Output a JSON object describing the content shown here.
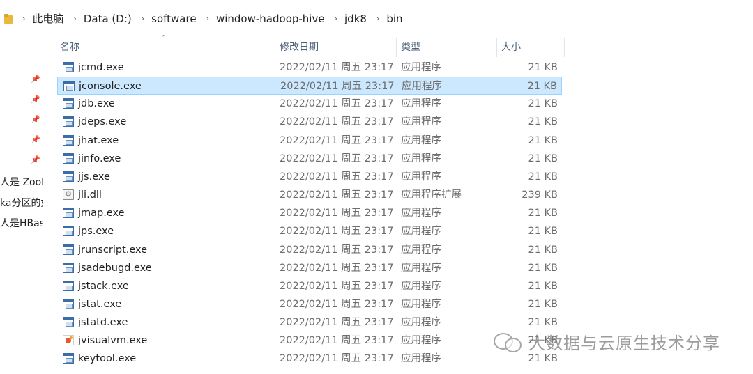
{
  "breadcrumb": [
    "此电脑",
    "Data (D:)",
    "software",
    "window-hadoop-hive",
    "jdk8",
    "bin"
  ],
  "nav_items": [
    "人是 ZooK",
    "ka分区的如",
    "人是HBase"
  ],
  "columns": {
    "name": "名称",
    "date": "修改日期",
    "type": "类型",
    "size": "大小"
  },
  "files": [
    {
      "name": "jcmd.exe",
      "date": "2022/02/11 周五 23:17",
      "type": "应用程序",
      "size": "21 KB",
      "icon": "exe-icon"
    },
    {
      "name": "jconsole.exe",
      "date": "2022/02/11 周五 23:17",
      "type": "应用程序",
      "size": "21 KB",
      "icon": "exe-icon",
      "selected": true
    },
    {
      "name": "jdb.exe",
      "date": "2022/02/11 周五 23:17",
      "type": "应用程序",
      "size": "21 KB",
      "icon": "exe-icon"
    },
    {
      "name": "jdeps.exe",
      "date": "2022/02/11 周五 23:17",
      "type": "应用程序",
      "size": "21 KB",
      "icon": "exe-icon"
    },
    {
      "name": "jhat.exe",
      "date": "2022/02/11 周五 23:17",
      "type": "应用程序",
      "size": "21 KB",
      "icon": "exe-icon"
    },
    {
      "name": "jinfo.exe",
      "date": "2022/02/11 周五 23:17",
      "type": "应用程序",
      "size": "21 KB",
      "icon": "exe-icon"
    },
    {
      "name": "jjs.exe",
      "date": "2022/02/11 周五 23:17",
      "type": "应用程序",
      "size": "21 KB",
      "icon": "exe-icon"
    },
    {
      "name": "jli.dll",
      "date": "2022/02/11 周五 23:17",
      "type": "应用程序扩展",
      "size": "239 KB",
      "icon": "dll-icon"
    },
    {
      "name": "jmap.exe",
      "date": "2022/02/11 周五 23:17",
      "type": "应用程序",
      "size": "21 KB",
      "icon": "exe-icon"
    },
    {
      "name": "jps.exe",
      "date": "2022/02/11 周五 23:17",
      "type": "应用程序",
      "size": "21 KB",
      "icon": "exe-icon"
    },
    {
      "name": "jrunscript.exe",
      "date": "2022/02/11 周五 23:17",
      "type": "应用程序",
      "size": "21 KB",
      "icon": "exe-icon"
    },
    {
      "name": "jsadebugd.exe",
      "date": "2022/02/11 周五 23:17",
      "type": "应用程序",
      "size": "21 KB",
      "icon": "exe-icon"
    },
    {
      "name": "jstack.exe",
      "date": "2022/02/11 周五 23:17",
      "type": "应用程序",
      "size": "21 KB",
      "icon": "exe-icon"
    },
    {
      "name": "jstat.exe",
      "date": "2022/02/11 周五 23:17",
      "type": "应用程序",
      "size": "21 KB",
      "icon": "exe-icon"
    },
    {
      "name": "jstatd.exe",
      "date": "2022/02/11 周五 23:17",
      "type": "应用程序",
      "size": "21 KB",
      "icon": "exe-icon"
    },
    {
      "name": "jvisualvm.exe",
      "date": "2022/02/11 周五 23:17",
      "type": "应用程序",
      "size": "21 KB",
      "icon": "visualvm-icon"
    },
    {
      "name": "keytool.exe",
      "date": "2022/02/11 周五 23:17",
      "type": "应用程序",
      "size": "21 KB",
      "icon": "exe-icon"
    }
  ],
  "watermark": "大数据与云原生技术分享"
}
